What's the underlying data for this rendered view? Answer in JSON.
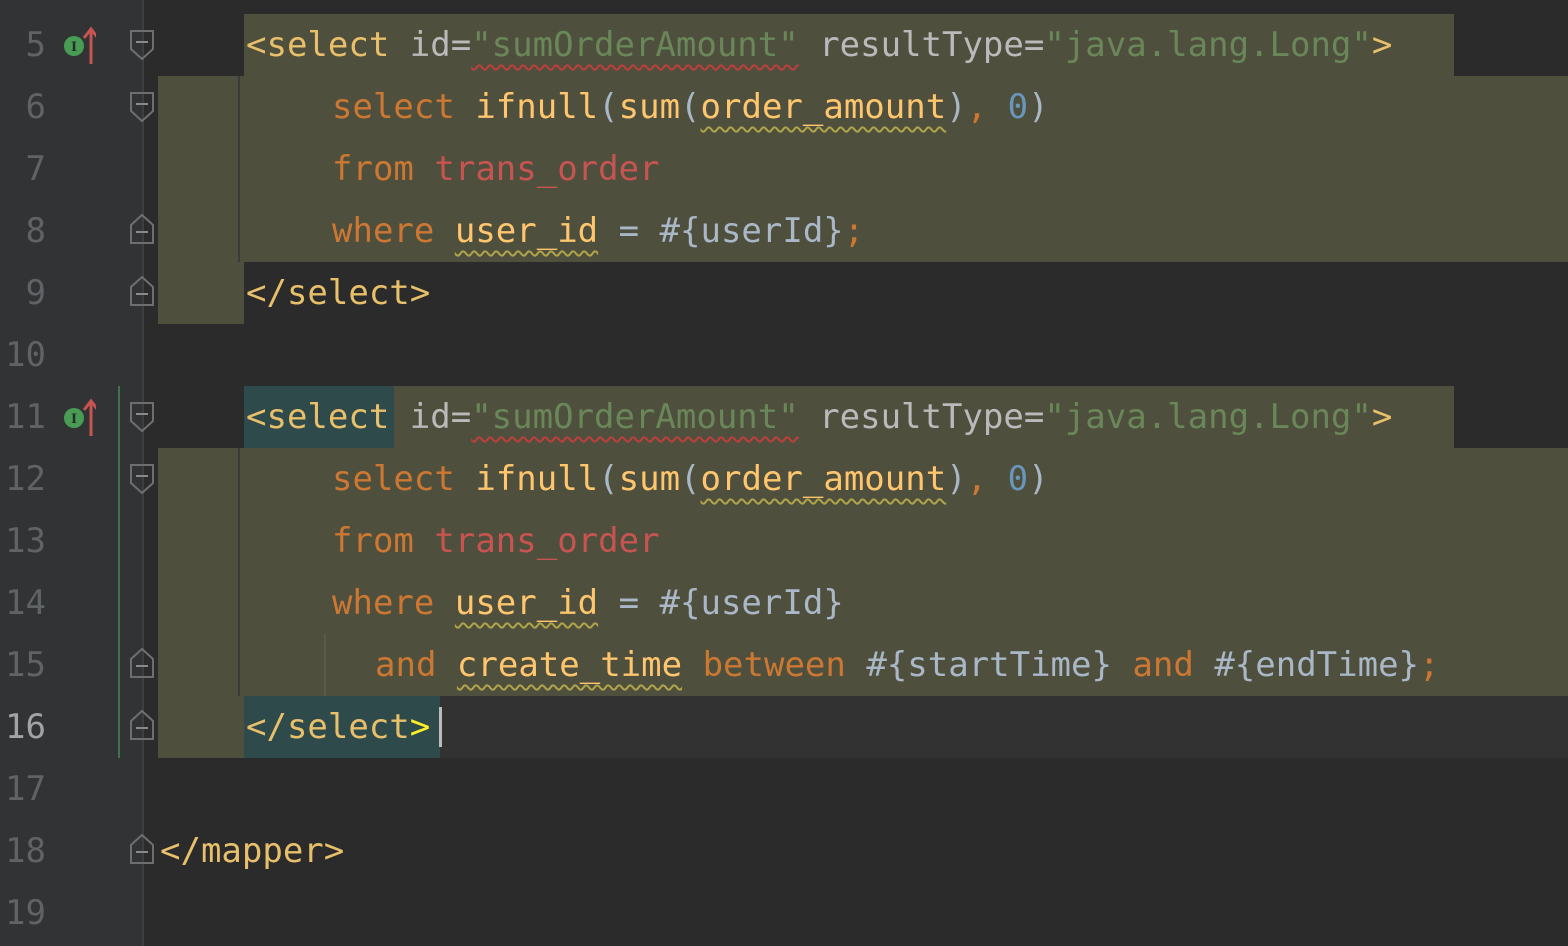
{
  "editor": {
    "colors": {
      "background": "#2b2b2b",
      "gutter": "#313335",
      "selection_highlight": "#4f4f3e",
      "tag": "#e8bf6a",
      "string": "#6a8759",
      "keyword": "#cc7832",
      "function": "#ffc66d",
      "table": "#c75450",
      "number": "#6897bb"
    },
    "cursor_line": 16,
    "lines": [
      {
        "num": "5"
      },
      {
        "num": "6"
      },
      {
        "num": "7"
      },
      {
        "num": "8"
      },
      {
        "num": "9"
      },
      {
        "num": "10"
      },
      {
        "num": "11"
      },
      {
        "num": "12"
      },
      {
        "num": "13"
      },
      {
        "num": "14"
      },
      {
        "num": "15"
      },
      {
        "num": "16"
      },
      {
        "num": "17"
      },
      {
        "num": "18"
      },
      {
        "num": "19"
      }
    ],
    "tokens": {
      "l5": [
        "<select",
        " id=",
        "\"sumOrderAmount\"",
        " resultType=",
        "\"java.lang.Long\"",
        ">"
      ],
      "l6": [
        "select",
        " ",
        "ifnull",
        "(",
        "sum",
        "(",
        "order_amount",
        ")",
        ", ",
        "0",
        ")"
      ],
      "l7": [
        "from",
        " ",
        "trans_order"
      ],
      "l8": [
        "where",
        " ",
        "user_id",
        " = #{userId}",
        ";"
      ],
      "l9": [
        "</select>"
      ],
      "l11": [
        "<select",
        " id=",
        "\"sumOrderAmount\"",
        " resultType=",
        "\"java.lang.Long\"",
        ">"
      ],
      "l12": [
        "select",
        " ",
        "ifnull",
        "(",
        "sum",
        "(",
        "order_amount",
        ")",
        ", ",
        "0",
        ")"
      ],
      "l13": [
        "from",
        " ",
        "trans_order"
      ],
      "l14": [
        "where",
        " ",
        "user_id",
        " = #{userId}"
      ],
      "l15": [
        "and",
        " ",
        "create_time",
        " ",
        "between",
        " #{startTime} ",
        "and",
        " #{endTime}",
        ";"
      ],
      "l16": [
        "</select",
        ">"
      ],
      "l18": [
        "</mapper>"
      ]
    },
    "gutter_icons": [
      "implemented-up-icon",
      "fold-icon"
    ]
  }
}
